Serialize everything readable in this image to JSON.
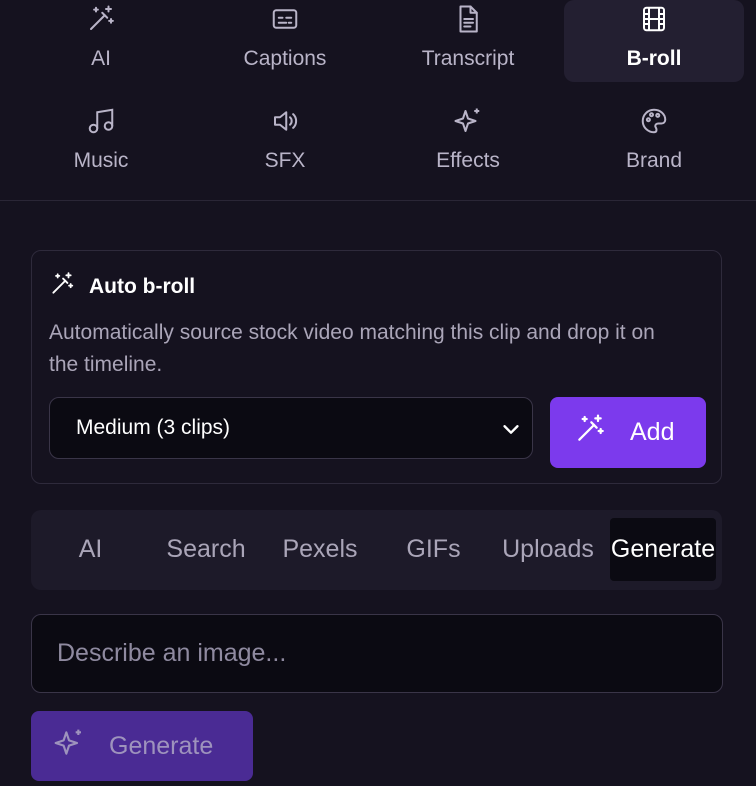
{
  "tool_grid": {
    "items": [
      {
        "label": "AI",
        "icon": "magic-wand-icon"
      },
      {
        "label": "Captions",
        "icon": "captions-icon"
      },
      {
        "label": "Transcript",
        "icon": "document-icon"
      },
      {
        "label": "B-roll",
        "icon": "film-icon",
        "active": true
      },
      {
        "label": "Music",
        "icon": "music-note-icon"
      },
      {
        "label": "SFX",
        "icon": "speaker-icon"
      },
      {
        "label": "Effects",
        "icon": "sparkles-icon"
      },
      {
        "label": "Brand",
        "icon": "palette-icon"
      }
    ]
  },
  "auto_broll": {
    "title": "Auto b-roll",
    "description": "Automatically source stock video matching this clip and drop it on the timeline.",
    "select_value": "Medium (3 clips)",
    "add_label": "Add"
  },
  "source_tabs": {
    "items": [
      "AI",
      "Search",
      "Pexels",
      "GIFs",
      "Uploads",
      "Generate"
    ],
    "active": "Generate"
  },
  "prompt": {
    "placeholder": "Describe an image..."
  },
  "generate_button": {
    "label": "Generate"
  },
  "colors": {
    "background": "#15121f",
    "accent": "#7c3aed",
    "accent_disabled": "#4a2b94"
  }
}
